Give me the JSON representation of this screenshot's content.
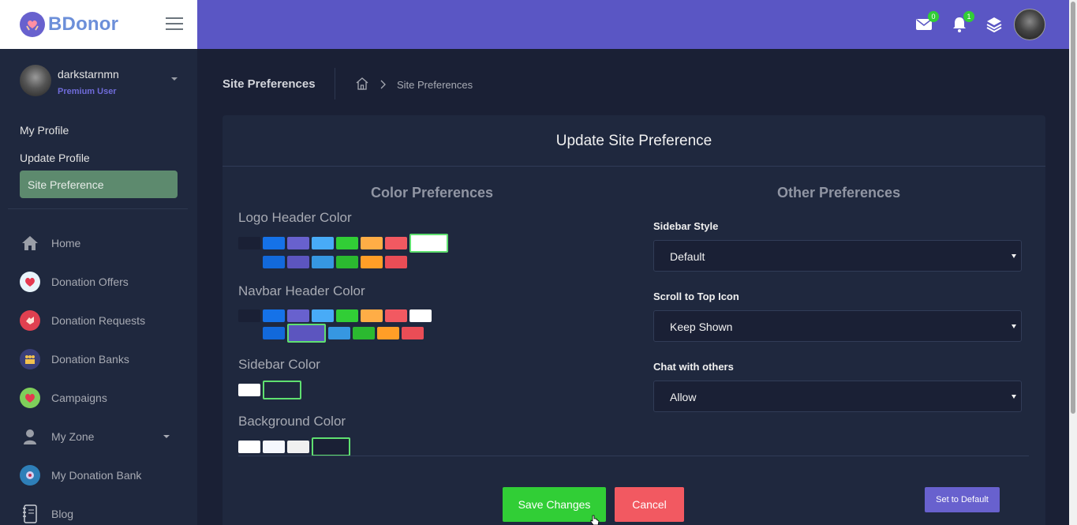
{
  "logo": {
    "text": "BDonor"
  },
  "navbar": {
    "messages_count": "0",
    "notifications_count": "1"
  },
  "user": {
    "name": "darkstarnmn",
    "role": "Premium User"
  },
  "profile_links": [
    {
      "label": "My Profile"
    },
    {
      "label": "Update Profile"
    },
    {
      "label": "Site Preference"
    }
  ],
  "menu": [
    {
      "label": "Home",
      "icon": "home-icon"
    },
    {
      "label": "Donation Offers",
      "icon": "heart-icon"
    },
    {
      "label": "Donation Requests",
      "icon": "hand-icon"
    },
    {
      "label": "Donation Banks",
      "icon": "people-icon"
    },
    {
      "label": "Campaigns",
      "icon": "campaign-icon"
    },
    {
      "label": "My Zone",
      "icon": "user-icon"
    },
    {
      "label": "My Donation Bank",
      "icon": "bank-icon"
    },
    {
      "label": "Blog",
      "icon": "notebook-icon"
    }
  ],
  "page": {
    "title": "Site Preferences",
    "breadcrumb": "Site Preferences"
  },
  "card": {
    "title": "Update Site Preference",
    "color_heading": "Color Preferences",
    "other_heading": "Other Preferences"
  },
  "color_prefs": {
    "logo_header": {
      "label": "Logo Header Color",
      "row1": [
        "#1a2035",
        "#1572e8",
        "#6861ce",
        "#48abf7",
        "#31ce36",
        "#ffad46",
        "#f25961",
        "#ffffff"
      ],
      "row2": [
        "#1f283e",
        "#1269db",
        "#5c55bf",
        "#3697e1",
        "#2bb930",
        "#ff9e27",
        "#ea4d56"
      ],
      "selected": "#ffffff"
    },
    "navbar_header": {
      "label": "Navbar Header Color",
      "row1": [
        "#1a2035",
        "#1572e8",
        "#6861ce",
        "#48abf7",
        "#31ce36",
        "#ffad46",
        "#f25961",
        "#ffffff"
      ],
      "row2": [
        "#1f283e",
        "#1269db",
        "#5c55bf",
        "#3697e1",
        "#2bb930",
        "#ff9e27",
        "#ea4d56"
      ],
      "selected": "#5c55bf"
    },
    "sidebar": {
      "label": "Sidebar Color",
      "swatches": [
        "#ffffff",
        "#1f283e"
      ],
      "selected": "#1f283e"
    },
    "background": {
      "label": "Background Color",
      "swatches": [
        "#ffffff",
        "#f5f7fd",
        "#f0f0f0",
        "#1a2035"
      ],
      "selected": "#1a2035"
    }
  },
  "other_prefs": [
    {
      "label": "Sidebar Style",
      "value": "Default"
    },
    {
      "label": "Scroll to Top Icon",
      "value": "Keep Shown"
    },
    {
      "label": "Chat with others",
      "value": "Allow"
    }
  ],
  "buttons": {
    "save": "Save Changes",
    "cancel": "Cancel",
    "default": "Set to Default"
  },
  "colors": {
    "navbar": "#5a56c4",
    "sidebar": "#1f283e",
    "background": "#1a2035",
    "accent": "#6861ce",
    "success": "#31ce36",
    "danger": "#f25961"
  }
}
